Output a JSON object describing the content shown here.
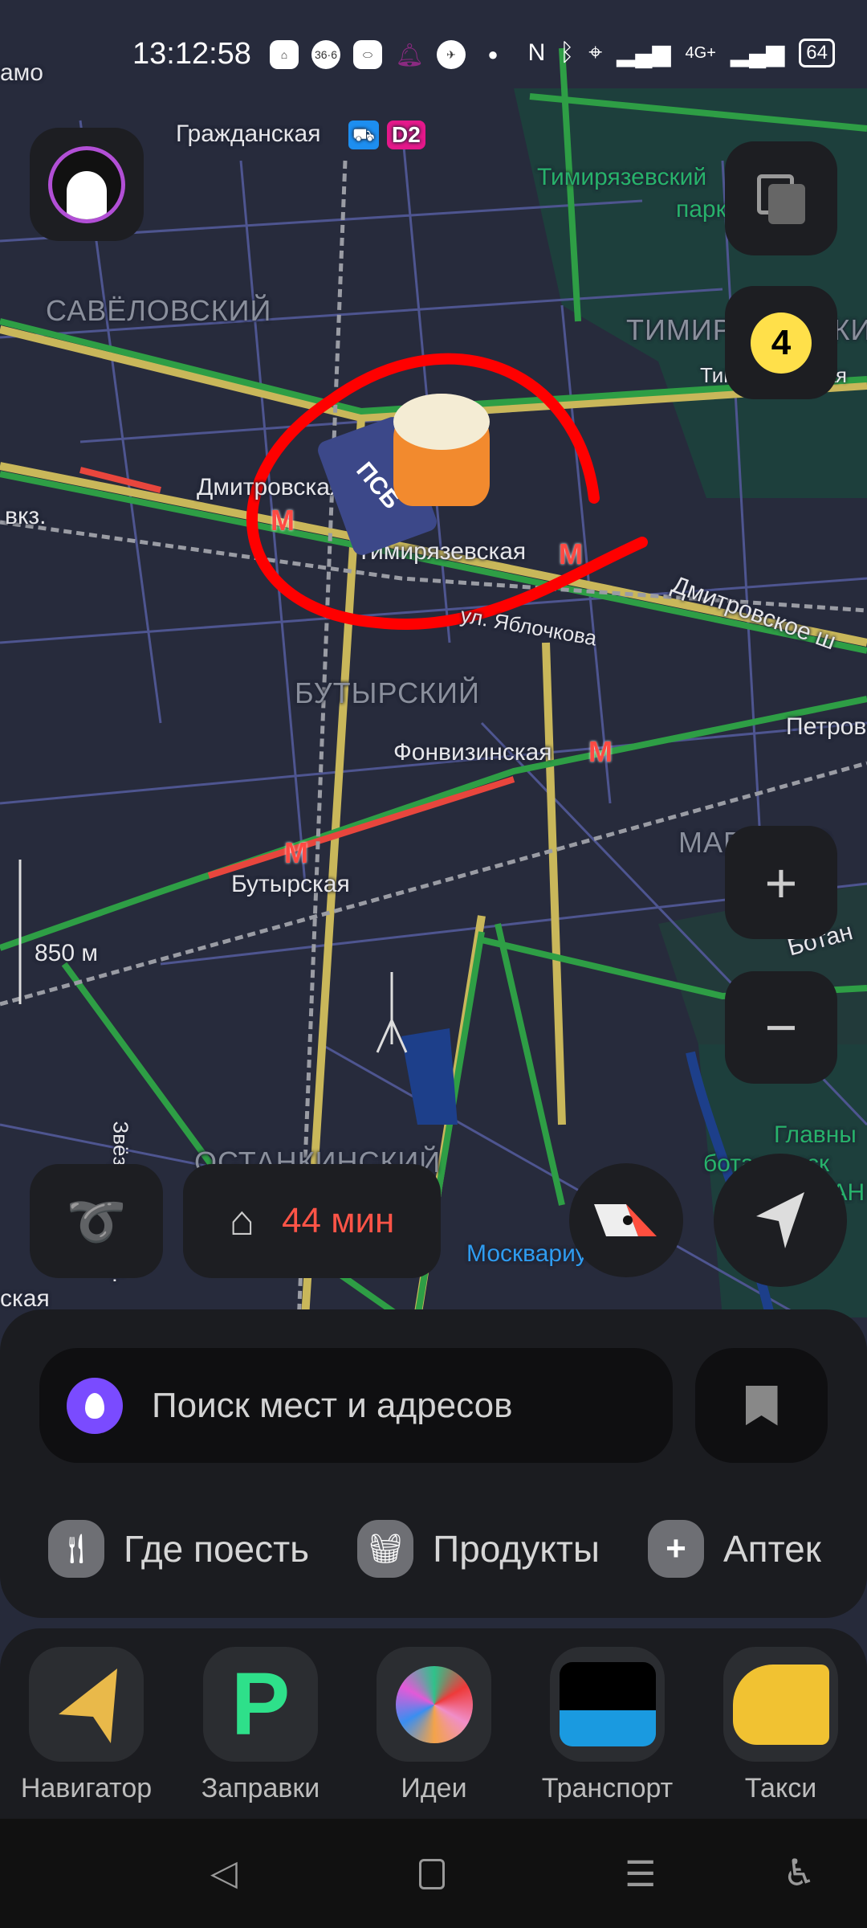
{
  "status_bar": {
    "time": "13:12:58",
    "notif_icons": [
      "home-app-icon",
      "pharmacy-366-icon",
      "oval-app-icon",
      "bell-icon",
      "bird-app-icon",
      "dot-icon"
    ],
    "network": "4G+",
    "battery": "64"
  },
  "map": {
    "labels": {
      "amo": "амо",
      "grazhdanskaya": "Гражданская",
      "d2": "D2",
      "timiryazevsky_park_1": "Тимирязевский",
      "timiryazevsky_park_2": "парк",
      "savelovsky": "САВЁЛОВСКИЙ",
      "timiryazevsky": "ТИМИРЯЗЕВСКИЙ",
      "timiryazevskaya_street": "Тимирязевская",
      "dmitrovskaya": "Дмитровская",
      "vkz": "вкз.",
      "timiryazevskaya_station": "Тимирязевская",
      "dmitrovskoe": "Дмитровское ш",
      "yablochkova": "ул. Яблочкова",
      "butyrsky": "БУТЫРСКИЙ",
      "petrov": "Петров",
      "fonvizinskaya": "Фонвизинская",
      "marfino": "МАРФИНО",
      "butyrskaya": "Бутырская",
      "botan": "Ботан",
      "zvezdny": "Звёздный бульв.",
      "ostankinsky": "ОСТАНКИНСКИЙ",
      "garden_1": "Главны",
      "garden_2": "ботаническ",
      "garden_3": "сад РАН",
      "moskvarium": "Москвариум",
      "skaya": "ская"
    },
    "metro_symbol": "М",
    "scale": "850 м",
    "ad_pin": {
      "brand": "ПСБ"
    },
    "traffic_score": "4"
  },
  "controls": {
    "home_eta": "44 мин",
    "colors": {
      "eta": "#ff5447",
      "traffic_score": "#ffe04a",
      "annotation": "#ff0000"
    }
  },
  "search": {
    "placeholder": "Поиск мест и адресов"
  },
  "categories": [
    {
      "icon": "fork-knife-icon",
      "label": "Где поесть"
    },
    {
      "icon": "basket-icon",
      "label": "Продукты"
    },
    {
      "icon": "plus-icon",
      "label": "Аптек"
    }
  ],
  "apps": [
    {
      "label": "Навигатор"
    },
    {
      "label": "Заправки"
    },
    {
      "label": "Идеи"
    },
    {
      "label": "Транспорт"
    },
    {
      "label": "Такси"
    }
  ]
}
